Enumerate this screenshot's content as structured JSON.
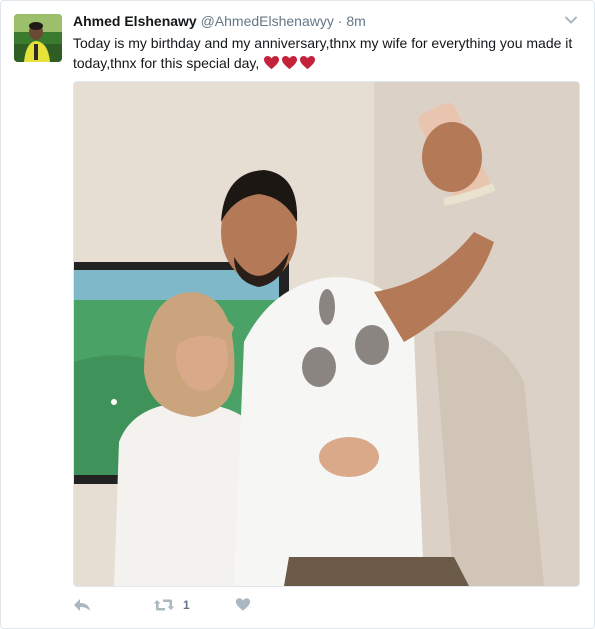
{
  "tweet": {
    "author_name": "Ahmed Elshenawy",
    "handle": "@AhmedElshenawyy",
    "separator": "·",
    "time": "8m",
    "text": "Today is my birthday and my anniversary,thnx my wife for everything you made it today,thnx for this special day,",
    "emoji": [
      "heart",
      "heart",
      "heart"
    ],
    "photo_alt": "Selfie of a couple in front of a TV showing a football match"
  },
  "actions": {
    "reply_icon": "reply-icon",
    "retweet_icon": "retweet-icon",
    "retweet_count": "1",
    "like_icon": "heart-icon"
  },
  "colors": {
    "heart": "#c4213b",
    "icon_gray": "#aab8c2",
    "text_secondary": "#657786"
  }
}
